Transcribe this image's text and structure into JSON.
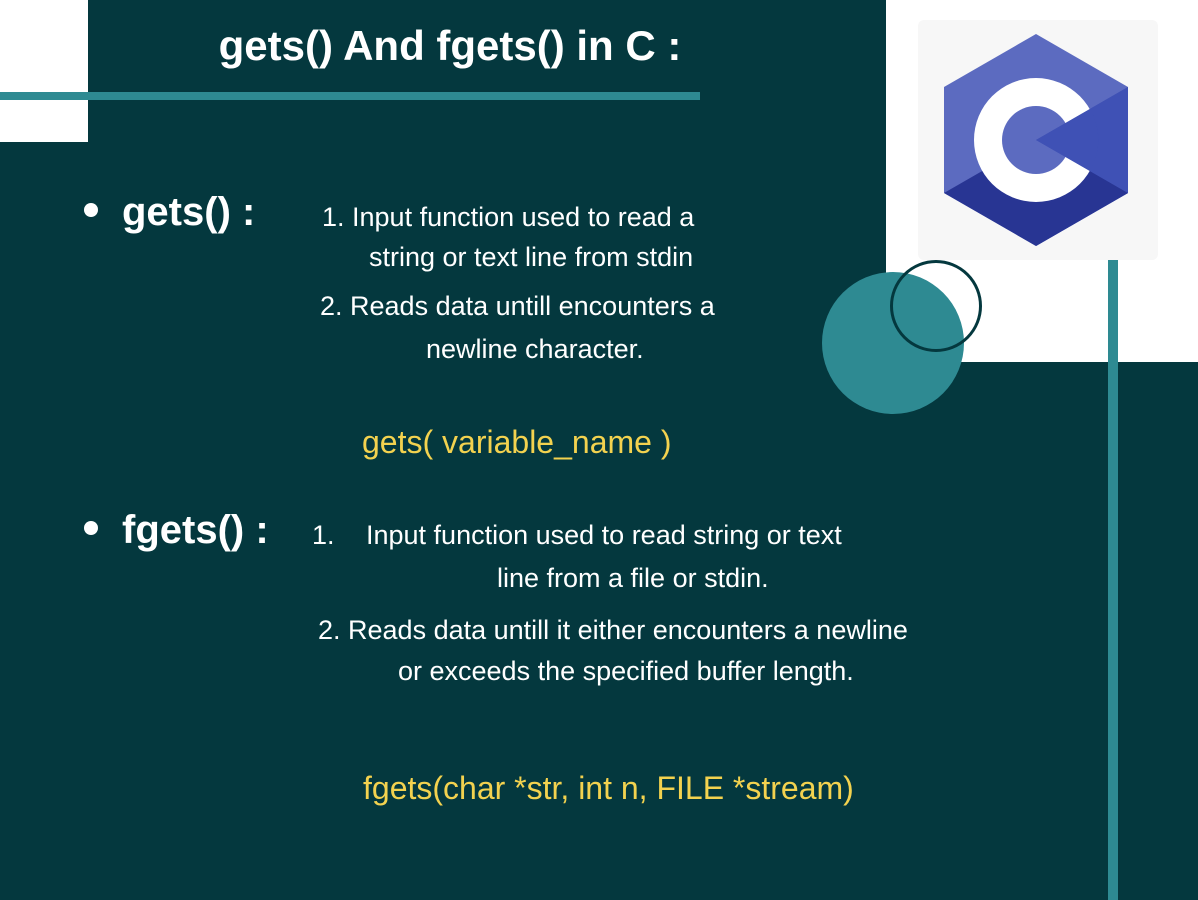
{
  "title": "gets() And fgets() in C :",
  "sections": [
    {
      "heading": "gets() :",
      "point1_line1": "1.  Input function used to read a",
      "point1_line2": "string or text line from stdin",
      "point2_line1": "2. Reads  data untill encounters a",
      "point2_line2": "newline character.",
      "syntax": "gets( variable_name )"
    },
    {
      "heading": "fgets() :",
      "point1_number": "1.",
      "point1_line1": "Input function used to read  string or text",
      "point1_line2": "line from a file or stdin.",
      "point2_line1": "2. Reads data untill it either encounters a newline",
      "point2_line2": "or exceeds the specified buffer length.",
      "syntax": "fgets(char *str, int n, FILE *stream)"
    }
  ],
  "logo": {
    "icon": "c-language-logo-icon",
    "colors": [
      "#5c6bc0",
      "#3f51b5",
      "#283593",
      "#ffffff"
    ]
  },
  "colors": {
    "background": "#04383e",
    "accent": "#2e8a92",
    "code": "#f3d24f",
    "text": "#ffffff"
  }
}
